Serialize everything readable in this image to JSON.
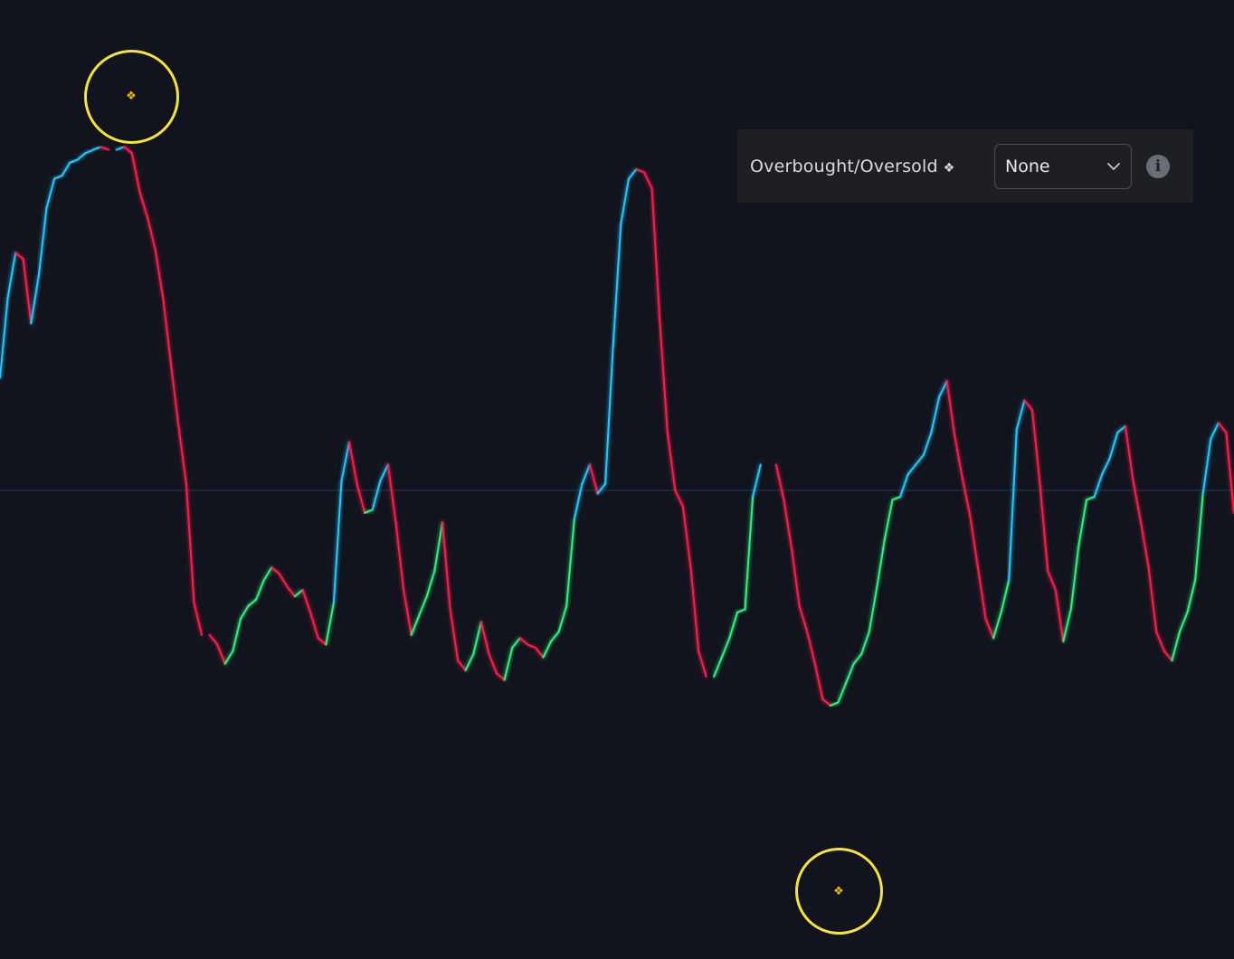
{
  "chart_data": {
    "type": "line",
    "series": [
      {
        "values": [
          35,
          60,
          74,
          72,
          52,
          67,
          88,
          97,
          98,
          102,
          103,
          105,
          106,
          107,
          106,
          106,
          107,
          105,
          93,
          85,
          75,
          60,
          40,
          20,
          2,
          -35,
          -45,
          -45,
          -48,
          -54,
          -50,
          -40,
          -36,
          -34,
          -28,
          -24,
          -26,
          -30,
          -33,
          -31,
          -38,
          -46,
          -48,
          -35,
          3,
          15,
          2,
          -7,
          -6,
          3,
          8,
          -10,
          -31,
          -45,
          -39,
          -33,
          -25,
          -10,
          -37,
          -53,
          -56,
          -51,
          -41,
          -51,
          -57,
          -59,
          -49,
          -46,
          -48,
          -49,
          -52,
          -47,
          -44,
          -36,
          -9,
          2,
          8,
          -1,
          2,
          45,
          83,
          97,
          100,
          99,
          94,
          53,
          18,
          0,
          -5,
          -24,
          -50,
          -58,
          -58,
          -52,
          -46,
          -38,
          -37,
          -2,
          8,
          8,
          8,
          -3,
          -18,
          -36,
          -44,
          -54,
          -65,
          -67,
          -66,
          -60,
          -54,
          -51,
          -44,
          -30,
          -15,
          -3,
          -2,
          5,
          8,
          11,
          18,
          29,
          34,
          17,
          4,
          -8,
          -24,
          -40,
          -46,
          -38,
          -28,
          19,
          28,
          25,
          2,
          -25,
          -31,
          -47,
          -37,
          -17,
          -3,
          -2,
          5,
          10,
          18,
          20,
          3,
          -10,
          -24,
          -44,
          -50,
          -53,
          -44,
          -38,
          -28,
          -1,
          16,
          21,
          18,
          -7
        ]
      }
    ],
    "ylim": [
      -150,
      150
    ],
    "zero_line": true,
    "colors": {
      "rising": "#22c8ff",
      "falling": "#ff1f4b",
      "recovering": "#2ef27d",
      "zero_line": "#1e3a55"
    },
    "markers": [
      {
        "kind": "overbought",
        "x_index": 18,
        "symbol": "❖"
      },
      {
        "kind": "oversold",
        "x_index": 108,
        "symbol": "❖"
      }
    ]
  },
  "settings": {
    "label": "Overbought/Oversold",
    "label_icon": "❖",
    "select_value": "None",
    "info_icon": "i",
    "chevron_icon": "chevron-down-icon"
  }
}
